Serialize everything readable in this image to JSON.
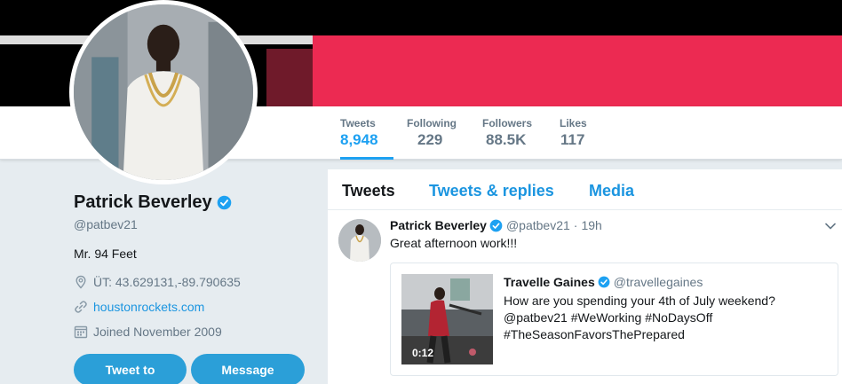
{
  "stats": [
    {
      "label": "Tweets",
      "value": "8,948"
    },
    {
      "label": "Following",
      "value": "229"
    },
    {
      "label": "Followers",
      "value": "88.5K"
    },
    {
      "label": "Likes",
      "value": "117"
    }
  ],
  "profile": {
    "name": "Patrick Beverley",
    "handle": "@patbev21",
    "bio": "Mr. 94 Feet",
    "location": "ÜT: 43.629131,-89.790635",
    "website": "houstonrockets.com",
    "joined": "Joined November 2009"
  },
  "buttons": {
    "tweet_to": "Tweet to",
    "message": "Message"
  },
  "tabs": [
    "Tweets",
    "Tweets & replies",
    "Media"
  ],
  "tweet": {
    "name": "Patrick Beverley",
    "handle": "@patbev21",
    "separator": "·",
    "time": "19h",
    "text": "Great afternoon work!!!",
    "quote": {
      "name": "Travelle Gaines",
      "handle": "@travellegaines",
      "text": "How are you spending your 4th of July weekend? @patbev21  #WeWorking #NoDaysOff #TheSeasonFavorsThePrepared",
      "video_duration": "0:12"
    }
  },
  "colors": {
    "accent": "#1da1f2",
    "link": "#1b95e0",
    "button": "#2b9fd8",
    "banner_red": "#ec2a52"
  },
  "icons": {
    "verified": "verified-badge-icon",
    "location": "location-pin-icon",
    "link": "link-icon",
    "calendar": "calendar-icon",
    "caret": "chevron-down-icon"
  }
}
